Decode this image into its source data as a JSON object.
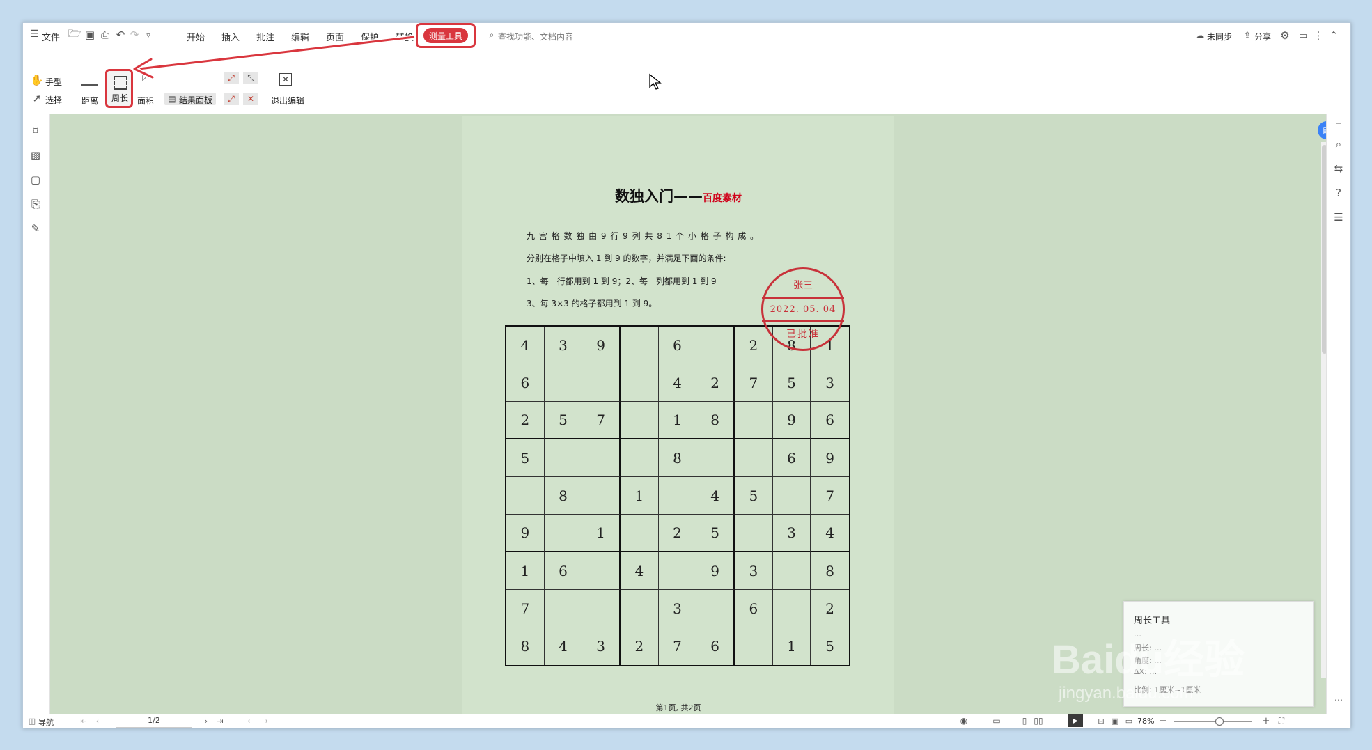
{
  "menubar": {
    "file_label": "文件",
    "tabs": [
      "开始",
      "插入",
      "批注",
      "编辑",
      "页面",
      "保护",
      "转换"
    ],
    "active_tab": "测量工具",
    "search_placeholder": "查找功能、文档内容",
    "sync_label": "未同步",
    "share_label": "分享"
  },
  "ribbon": {
    "hand_label": "手型",
    "select_label": "选择",
    "distance_label": "距离",
    "perimeter_label": "周长",
    "area_label": "面积",
    "result_panel_label": "结果面板",
    "exit_label": "退出编辑"
  },
  "document": {
    "title": "数独入门——",
    "title_suffix": "百度素材",
    "lines": [
      "九 宫 格 数 独 由 9 行 9 列 共 8 1 个 小 格 子 构 成 。",
      "分别在格子中填入 1 到 9 的数字，并满足下面的条件:",
      "1、每一行都用到 1 到 9；2、每一列都用到 1 到 9",
      "3、每 3×3 的格子都用到 1 到 9。"
    ],
    "grid": [
      [
        "4",
        "3",
        "9",
        "",
        "6",
        "",
        "2",
        "8",
        "1"
      ],
      [
        "6",
        "",
        "",
        "",
        "4",
        "2",
        "7",
        "5",
        "3"
      ],
      [
        "2",
        "5",
        "7",
        "",
        "1",
        "8",
        "",
        "9",
        "6"
      ],
      [
        "5",
        "",
        "",
        "",
        "8",
        "",
        "",
        "6",
        "9"
      ],
      [
        "",
        "8",
        "",
        "1",
        "",
        "4",
        "5",
        "",
        "7"
      ],
      [
        "9",
        "",
        "1",
        "",
        "2",
        "5",
        "",
        "3",
        "4"
      ],
      [
        "1",
        "6",
        "",
        "4",
        "",
        "9",
        "3",
        "",
        "8"
      ],
      [
        "7",
        "",
        "",
        "",
        "3",
        "",
        "6",
        "",
        "2"
      ],
      [
        "8",
        "4",
        "3",
        "2",
        "7",
        "6",
        "",
        "1",
        "5"
      ]
    ],
    "stamp": {
      "name": "张三",
      "date": "2022. 05. 04",
      "status": "已批准"
    },
    "footer": "第1页, 共2页"
  },
  "perimeter_panel": {
    "title": "周长工具",
    "rows": [
      "…",
      "周长: …",
      "角度: …",
      "ΔX: …"
    ],
    "scale": "比例: 1厘米=1厘米"
  },
  "statusbar": {
    "nav_label": "导航",
    "page_indicator": "1/2",
    "zoom": "78%"
  },
  "watermark": {
    "brand": "Baidu经验",
    "url": "jingyan.baidu.com"
  },
  "colors": {
    "accent_red": "#d9363e",
    "page_bg": "#d2e3cc",
    "canvas_bg": "#cbdcc5"
  }
}
